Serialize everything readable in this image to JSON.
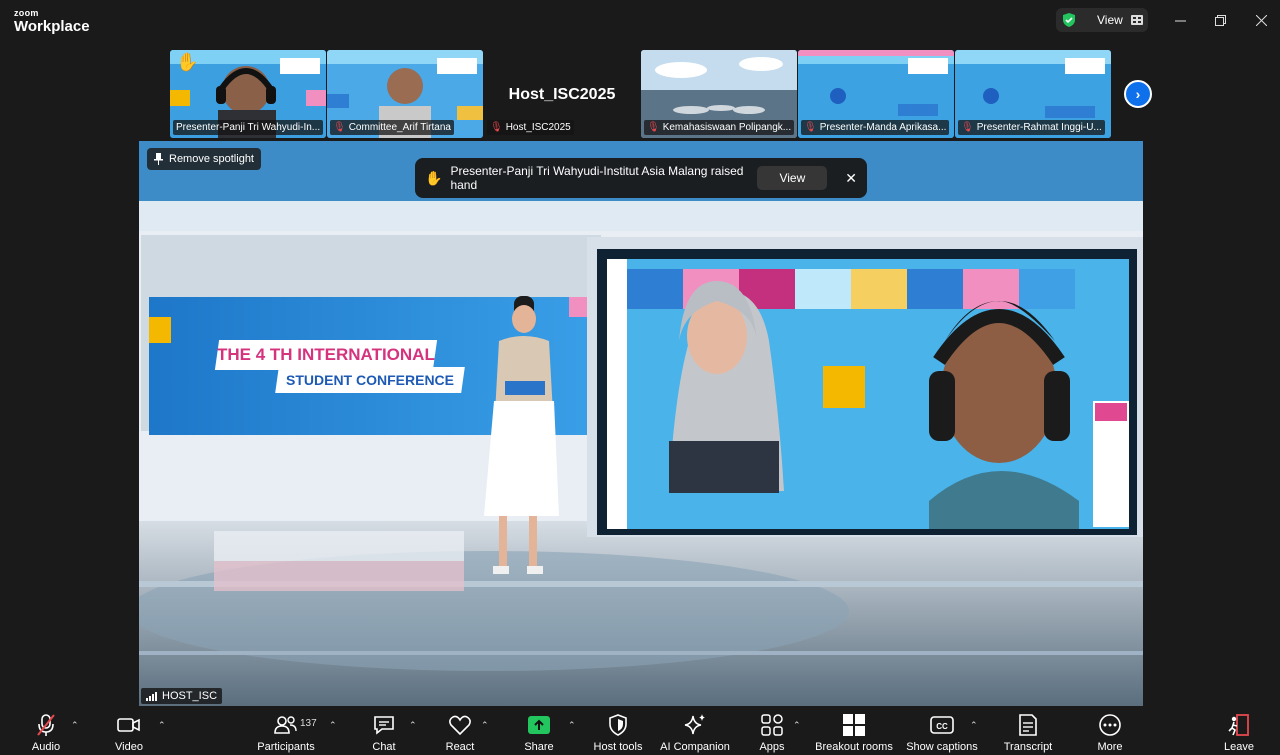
{
  "titlebar": {
    "brand_small": "zoom",
    "brand_large": "Workplace",
    "view_label": "View",
    "window_controls": [
      "minimize-icon",
      "restore-icon",
      "close-icon"
    ]
  },
  "thumbnails": [
    {
      "label": "Presenter-Panji Tri Wahyudi-In...",
      "muted": false,
      "hand": true
    },
    {
      "label": "Committee_Arif Tirtana",
      "muted": true
    },
    {
      "label": "Host_ISC2025",
      "muted": true,
      "name_overlay": "Host_ISC2025"
    },
    {
      "label": "Kemahasiswaan Polipangk...",
      "muted": true
    },
    {
      "label": "Presenter-Manda Aprikasa...",
      "muted": true
    },
    {
      "label": "Presenter-Rahmat Inggi-U...",
      "muted": true
    }
  ],
  "stage": {
    "remove_spotlight": "Remove spotlight",
    "notification_text": "Presenter-Panji Tri Wahyudi-Institut Asia Malang raised hand",
    "notification_view": "View",
    "active_speaker": "HOST_ISC",
    "screen_line1": "THE 4 TH INTERNATIONAL",
    "screen_line2": "STUDENT CONFERENCE"
  },
  "toolbar": {
    "audio": "Audio",
    "video": "Video",
    "participants": "Participants",
    "participants_count": "137",
    "chat": "Chat",
    "react": "React",
    "share": "Share",
    "host_tools": "Host tools",
    "ai_companion": "AI Companion",
    "apps": "Apps",
    "breakout_rooms": "Breakout rooms",
    "show_captions": "Show captions",
    "transcript": "Transcript",
    "more": "More",
    "leave": "Leave"
  },
  "colors": {
    "accent": "#0e71eb",
    "share_green": "#22c55e",
    "mute_red": "#e5484d",
    "leave_red": "#e5484d"
  }
}
